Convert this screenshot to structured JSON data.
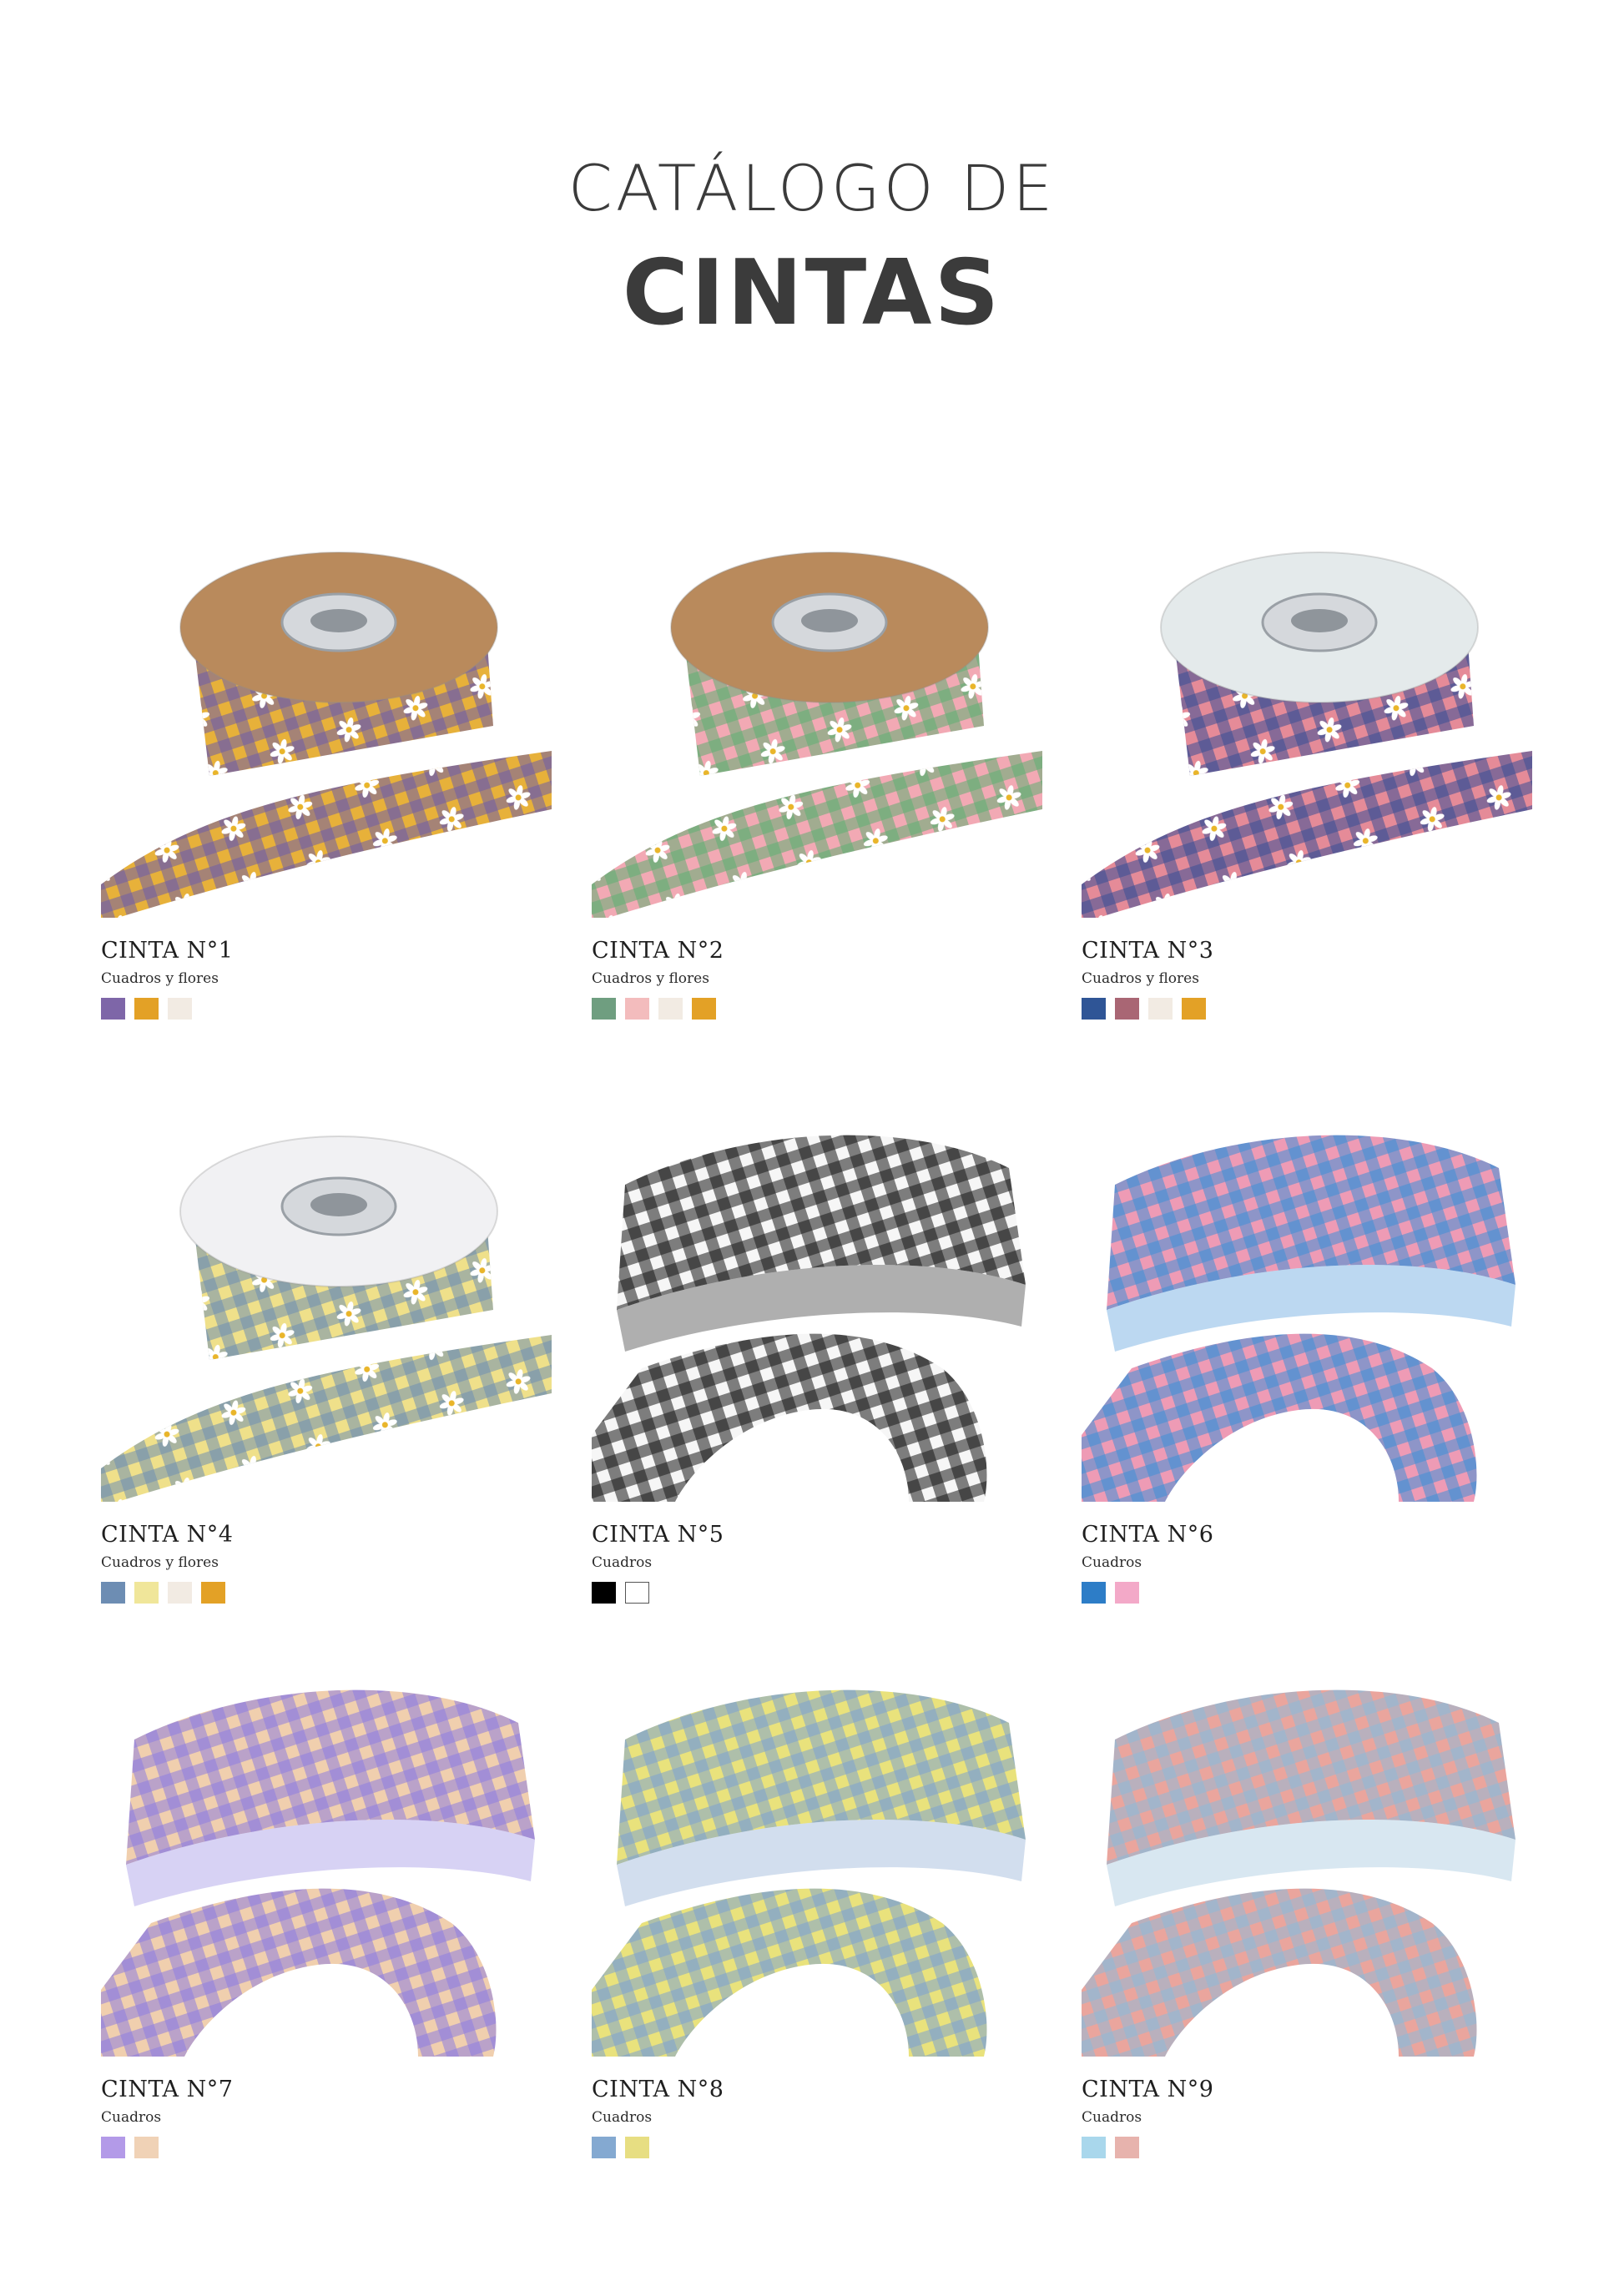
{
  "header": {
    "line1": "CATÁLOGO DE",
    "line2": "CINTAS"
  },
  "ribbons": [
    {
      "name": "CINTA N°1",
      "description": "Cuadros y flores",
      "colors": [
        "#7e66a8",
        "#e3a126",
        "#f2ebe3"
      ],
      "pattern": {
        "a": "#6e5ca8",
        "b": "#e7b13a",
        "bg": "#ffffff",
        "spool": "#b98a5c",
        "flowers": true
      }
    },
    {
      "name": "CINTA N°2",
      "description": "Cuadros y flores",
      "colors": [
        "#6f9e80",
        "#f3bcbd",
        "#f2ebe3",
        "#e3a126"
      ],
      "pattern": {
        "a": "#5fae72",
        "b": "#f2a9b4",
        "bg": "#ffffff",
        "spool": "#b98a5c",
        "flowers": true
      }
    },
    {
      "name": "CINTA N°3",
      "description": "Cuadros y flores",
      "colors": [
        "#2f5596",
        "#a96674",
        "#f2ebe3",
        "#e3a126"
      ],
      "pattern": {
        "a": "#3a4f95",
        "b": "#e58b98",
        "bg": "#ffffff",
        "spool": "#e4eaeb",
        "flowers": true
      }
    },
    {
      "name": "CINTA N°4",
      "description": "Cuadros y flores",
      "colors": [
        "#6d8db3",
        "#f0e69a",
        "#f2ebe3",
        "#e3a126"
      ],
      "pattern": {
        "a": "#6f8fb3",
        "b": "#efe08a",
        "bg": "#ffffff",
        "spool": "#f1f1f3",
        "flowers": true
      }
    },
    {
      "name": "CINTA N°5",
      "description": "Cuadros",
      "colors": [
        "#000000",
        "#ffffff"
      ],
      "pattern": {
        "a": "#1a1a1a",
        "b": "#f6f6f6",
        "bg": "#ffffff",
        "spool": "",
        "flowers": false
      }
    },
    {
      "name": "CINTA N°6",
      "description": "Cuadros",
      "colors": [
        "#2d7dc7",
        "#f3a9c8"
      ],
      "pattern": {
        "a": "#3f8fd6",
        "b": "#ee9bb5",
        "bg": "#ffffff",
        "spool": "",
        "flowers": false
      }
    },
    {
      "name": "CINTA N°7",
      "description": "Cuadros",
      "colors": [
        "#b39ae8",
        "#f0d2b6"
      ],
      "pattern": {
        "a": "#8d7ee0",
        "b": "#f0cfae",
        "bg": "#ffffff",
        "spool": "",
        "flowers": false
      }
    },
    {
      "name": "CINTA N°8",
      "description": "Cuadros",
      "colors": [
        "#84a9d1",
        "#e7de82"
      ],
      "pattern": {
        "a": "#7ea1cf",
        "b": "#e9e27c",
        "bg": "#ffffff",
        "spool": "",
        "flowers": false
      }
    },
    {
      "name": "CINTA N°9",
      "description": "Cuadros",
      "colors": [
        "#a9d7ec",
        "#e7b3ad"
      ],
      "pattern": {
        "a": "#8fbad6",
        "b": "#eaa59d",
        "bg": "#ffffff",
        "spool": "",
        "flowers": false
      }
    }
  ]
}
